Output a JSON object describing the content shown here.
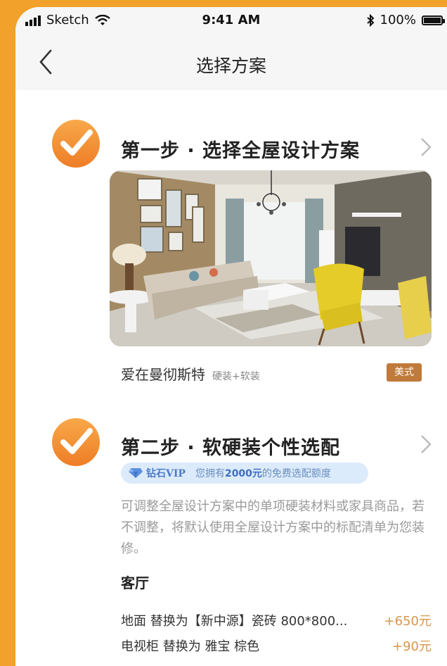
{
  "status_bar": {
    "carrier": "Sketch",
    "time": "9:41 AM",
    "battery": "100%"
  },
  "nav": {
    "title": "选择方案",
    "back_icon": "chevron-left-icon"
  },
  "step1": {
    "title": "第一步 · 选择全屋设计方案",
    "scheme_name": "爱在曼彻斯特",
    "scheme_sub": "硬装+软装",
    "style_tag": "美式"
  },
  "step2": {
    "title": "第二步 · 软硬装个性选配",
    "vip_label": "钻石VIP",
    "vip_text_pre": "您拥有",
    "vip_amount": "2000元",
    "vip_text_post": "的免费选配额度",
    "description": "可调整全屋设计方案中的单项硬装材料或家具商品，若不调整，将默认使用全屋设计方案中的标配清单为您装修。",
    "room": "客厅",
    "items": [
      {
        "text": "地面 替换为【新中源】瓷砖 800*800...",
        "price": "+650元"
      },
      {
        "text": "电视柜 替换为 雅宝 棕色",
        "price": "+90元"
      }
    ]
  },
  "colors": {
    "accent_orange": "#f2a12a",
    "check_orange": "#f08a2c",
    "price_orange": "#d9954a",
    "tag_brown": "#c07a3a",
    "vip_blue": "#dcebfb"
  }
}
